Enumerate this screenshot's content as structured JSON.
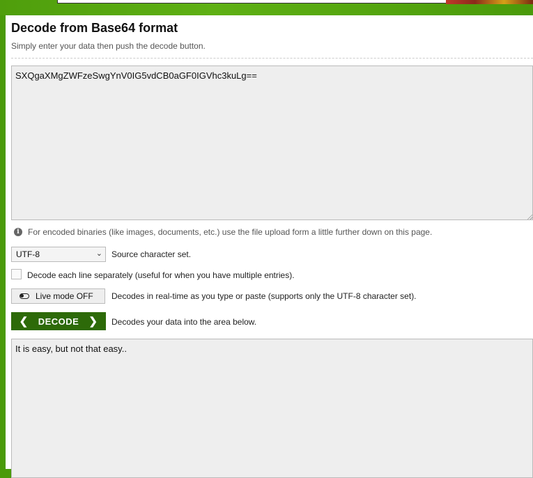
{
  "page": {
    "title": "Decode from Base64 format",
    "subtitle": "Simply enter your data then push the decode button."
  },
  "input": {
    "value": "SXQgaXMgZWFzeSwgYnV0IG5vdCB0aGF0IGVhc3kuLg=="
  },
  "info": {
    "text": "For encoded binaries (like images, documents, etc.) use the file upload form a little further down on this page."
  },
  "charset": {
    "selected": "UTF-8",
    "label": "Source character set."
  },
  "line_option": {
    "label": "Decode each line separately (useful for when you have multiple entries).",
    "checked": false
  },
  "live_mode": {
    "button_label": "Live mode OFF",
    "description": "Decodes in real-time as you type or paste (supports only the UTF-8 character set)."
  },
  "decode": {
    "button_label": "DECODE",
    "description": "Decodes your data into the area below."
  },
  "output": {
    "value": "It is easy, but not that easy.."
  }
}
